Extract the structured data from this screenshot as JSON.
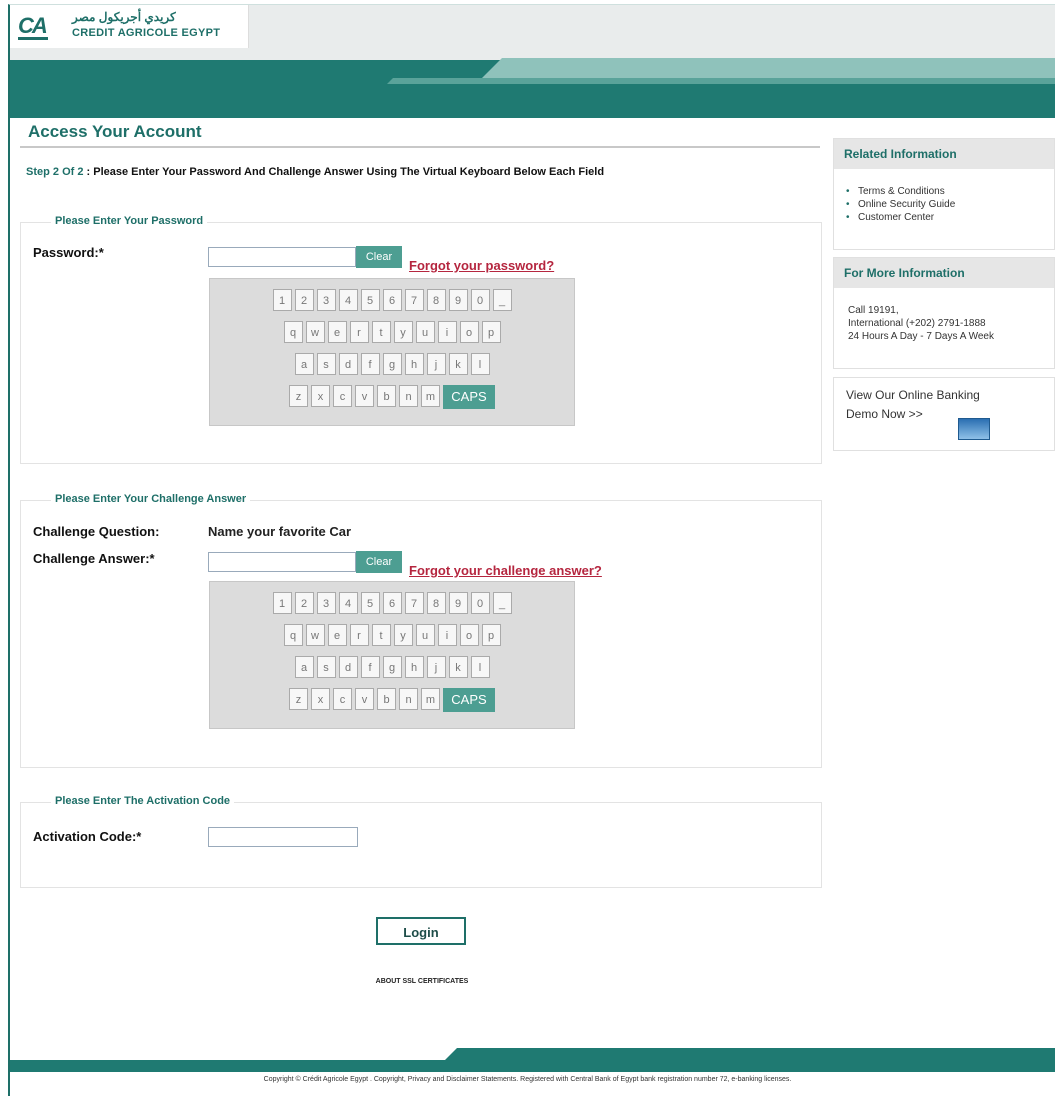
{
  "header": {
    "logo_mark": "CA",
    "logo_arabic": "كريدي أجريكول مصر",
    "logo_english": "CREDIT AGRICOLE EGYPT"
  },
  "main": {
    "title": "Access Your Account",
    "step_prefix": "Step 2 Of 2",
    "step_text": " : Please Enter Your Password And Challenge Answer Using The Virtual Keyboard Below Each Field",
    "password_section": {
      "legend": "Please Enter Your Password",
      "label": "Password:*",
      "value": "",
      "clear": "Clear",
      "forgot": "Forgot your password?"
    },
    "challenge_section": {
      "legend": "Please Enter Your Challenge Answer",
      "question_label": "Challenge Question:",
      "question_value": "Name your favorite Car",
      "answer_label": "Challenge Answer:*",
      "value": "",
      "clear": "Clear",
      "forgot": "Forgot your challenge answer?"
    },
    "activation_section": {
      "legend": "Please Enter The Activation Code",
      "label": "Activation Code:*",
      "value": ""
    },
    "keyboard": {
      "row1": [
        "1",
        "2",
        "3",
        "4",
        "5",
        "6",
        "7",
        "8",
        "9",
        "0",
        "_"
      ],
      "row2": [
        "q",
        "w",
        "e",
        "r",
        "t",
        "y",
        "u",
        "i",
        "o",
        "p"
      ],
      "row3": [
        "a",
        "s",
        "d",
        "f",
        "g",
        "h",
        "j",
        "k",
        "l"
      ],
      "row4": [
        "z",
        "x",
        "c",
        "v",
        "b",
        "n",
        "m"
      ],
      "caps": "CAPS"
    },
    "login": "Login",
    "ssl": "ABOUT SSL CERTIFICATES"
  },
  "sidebar": {
    "related": {
      "title": "Related Information",
      "items": [
        "Terms & Conditions",
        "Online Security Guide",
        "Customer Center"
      ]
    },
    "more": {
      "title": "For More Information",
      "line1": "Call 19191,",
      "line2": "International (+202) 2791-1888",
      "line3": "24 Hours A Day - 7 Days A Week"
    },
    "demo": {
      "line1": "View Our Online Banking",
      "line2": "Demo Now >>"
    }
  },
  "footer": {
    "copyright": "Copyright © Crédit Agricole Egypt . Copyright, Privacy and Disclaimer Statements. Registered with Central Bank of Egypt bank registration number 72, e-banking licenses."
  },
  "colors": {
    "brand": "#1e6f68",
    "accent": "#4d9e92",
    "link": "#b5263f"
  }
}
